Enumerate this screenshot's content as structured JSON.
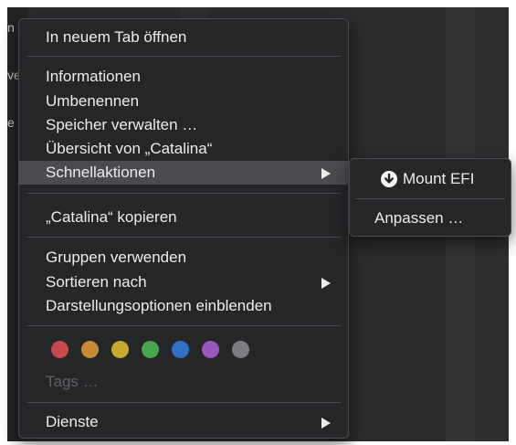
{
  "background": {
    "fragments": [
      "n",
      "ve",
      "e"
    ]
  },
  "menu": {
    "items": [
      {
        "label": "In neuem Tab öffnen"
      },
      {
        "label": "Informationen"
      },
      {
        "label": "Umbenennen"
      },
      {
        "label": "Speicher verwalten …"
      },
      {
        "label": "Übersicht von „Catalina“"
      },
      {
        "label": "Schnellaktionen",
        "submenu": true,
        "highlighted": true
      },
      {
        "label": "„Catalina“ kopieren"
      },
      {
        "label": "Gruppen verwenden"
      },
      {
        "label": "Sortieren nach",
        "submenu": true
      },
      {
        "label": "Darstellungsoptionen einblenden"
      }
    ],
    "tag_colors": [
      {
        "name": "red",
        "color": "#c7484d"
      },
      {
        "name": "orange",
        "color": "#c98a37"
      },
      {
        "name": "yellow",
        "color": "#c7a92f"
      },
      {
        "name": "green",
        "color": "#46a84b"
      },
      {
        "name": "blue",
        "color": "#2d72c4"
      },
      {
        "name": "purple",
        "color": "#9a56be"
      },
      {
        "name": "gray",
        "color": "#7c7d80"
      }
    ],
    "tags_placeholder": "Tags …",
    "services": {
      "label": "Dienste",
      "submenu": true
    }
  },
  "submenu": {
    "items": [
      {
        "label": "Mount EFI",
        "icon": "download-circle-icon"
      },
      {
        "label": "Anpassen …"
      }
    ]
  }
}
